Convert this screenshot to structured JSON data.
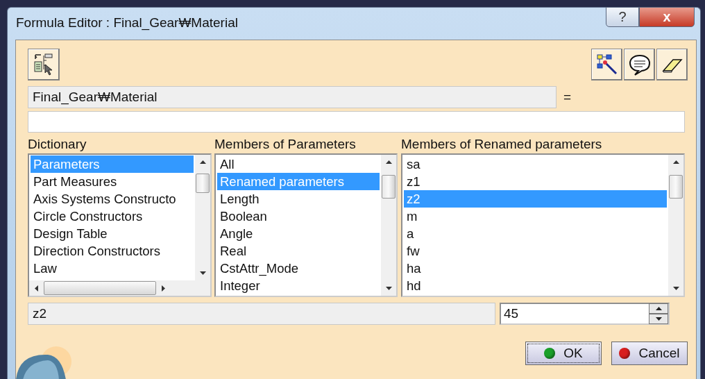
{
  "window": {
    "title": "Formula Editor : Final_Gear₩Material",
    "help_label": "?",
    "close_label": "x"
  },
  "formula_target": {
    "value": "Final_Gear₩Material",
    "equals": "="
  },
  "lists": [
    {
      "title": "Dictionary",
      "horizontal_scroll": true,
      "items": [
        {
          "label": "Parameters",
          "selected": true
        },
        {
          "label": "Part Measures",
          "selected": false
        },
        {
          "label": "Axis Systems Constructo",
          "selected": false
        },
        {
          "label": "Circle Constructors",
          "selected": false
        },
        {
          "label": "Design Table",
          "selected": false
        },
        {
          "label": "Direction Constructors",
          "selected": false
        },
        {
          "label": "Law",
          "selected": false
        }
      ]
    },
    {
      "title": "Members of Parameters",
      "horizontal_scroll": false,
      "items": [
        {
          "label": "All",
          "selected": false
        },
        {
          "label": "Renamed parameters",
          "selected": true
        },
        {
          "label": "Length",
          "selected": false
        },
        {
          "label": "Boolean",
          "selected": false
        },
        {
          "label": "Angle",
          "selected": false
        },
        {
          "label": "Real",
          "selected": false
        },
        {
          "label": "CstAttr_Mode",
          "selected": false
        },
        {
          "label": "Integer",
          "selected": false
        }
      ]
    },
    {
      "title": "Members of Renamed parameters",
      "horizontal_scroll": false,
      "items": [
        {
          "label": "sa",
          "selected": false
        },
        {
          "label": "z1",
          "selected": false
        },
        {
          "label": "z2",
          "selected": true
        },
        {
          "label": "m",
          "selected": false
        },
        {
          "label": "a",
          "selected": false
        },
        {
          "label": "fw",
          "selected": false
        },
        {
          "label": "ha",
          "selected": false
        },
        {
          "label": "hd",
          "selected": false
        }
      ]
    }
  ],
  "value_row": {
    "name": "z2",
    "value": "45"
  },
  "buttons": [
    {
      "label": "OK",
      "kind": "ok",
      "focused": true
    },
    {
      "label": "Cancel",
      "kind": "cancel",
      "focused": false
    }
  ]
}
